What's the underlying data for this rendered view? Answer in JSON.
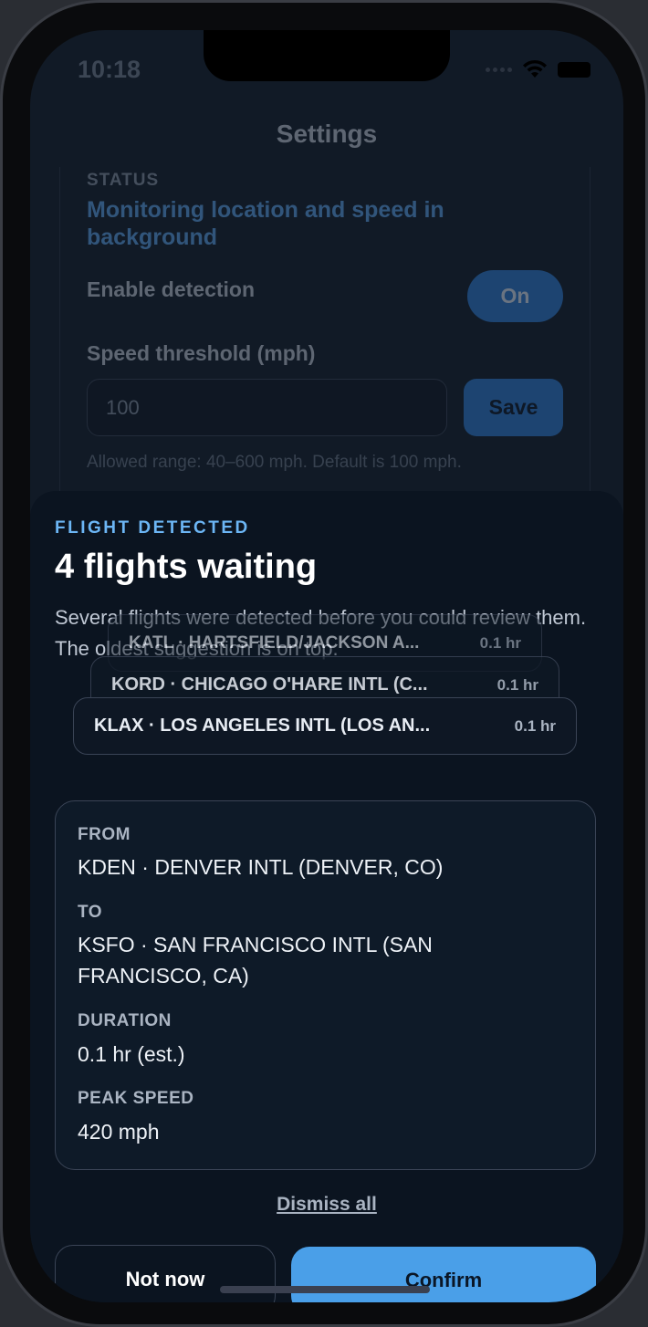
{
  "status_bar": {
    "time": "10:18",
    "icons": [
      "signal-icon",
      "wifi-icon",
      "battery-icon"
    ]
  },
  "settings": {
    "title": "Settings",
    "status_label": "STATUS",
    "status_value": "Monitoring location and speed in background",
    "enable_label": "Enable detection",
    "enable_value": "On",
    "threshold_label": "Speed threshold (mph)",
    "threshold_value": "100",
    "save_label": "Save",
    "helper_text": "Allowed range: 40–600 mph. Default is 100 mph."
  },
  "sheet": {
    "eyebrow": "FLIGHT DETECTED",
    "title": "4 flights waiting",
    "description": "Several flights were detected before you could review them. The oldest suggestion is on top.",
    "stacked_flights": [
      {
        "route": "KATL · HARTSFIELD/JACKSON A...",
        "duration": "0.1 hr"
      },
      {
        "route": "KORD · CHICAGO O'HARE INTL (C...",
        "duration": "0.1 hr"
      },
      {
        "route": "KLAX · LOS ANGELES INTL (LOS AN...",
        "duration": "0.1 hr"
      }
    ],
    "detail": {
      "from_label": "FROM",
      "from_value": "KDEN · DENVER INTL (DENVER, CO)",
      "to_label": "TO",
      "to_value": "KSFO · SAN FRANCISCO INTL (SAN FRANCISCO, CA)",
      "duration_label": "DURATION",
      "duration_value": "0.1 hr (est.)",
      "speed_label": "PEAK SPEED",
      "speed_value": "420 mph"
    },
    "dismiss_all": "Dismiss all",
    "not_now": "Not now",
    "confirm": "Confirm"
  },
  "colors": {
    "accent": "#4a9fe8",
    "eyebrow": "#6cb6f5",
    "background": "#0b1420"
  }
}
